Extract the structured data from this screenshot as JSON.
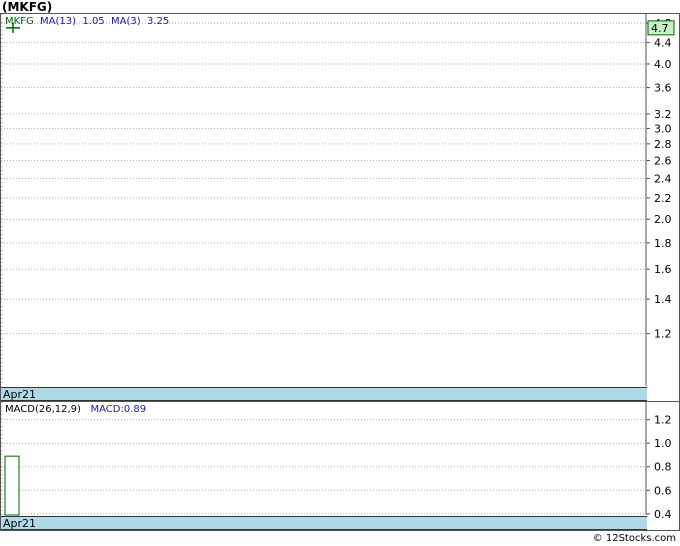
{
  "title": "(MKFG)",
  "footer": "© 12Stocks.com",
  "colors": {
    "axis_strip": "#b0dbe6",
    "price_series": "#006400",
    "ma_labels": "#1a1aa6",
    "last_price_badge": "#c8f0c8"
  },
  "price_legend": {
    "symbol": "MKFG",
    "ma13_label": "MA(13)",
    "ma13_value": "1.05",
    "ma3_label": "MA(3)",
    "ma3_value": "3.25"
  },
  "macd_legend": {
    "label": "MACD(26,12,9)",
    "macd_text": "MACD:0.89"
  },
  "chart_data": [
    {
      "type": "line",
      "panel": "price",
      "series": [
        {
          "name": "MKFG",
          "values": [
            4.7
          ]
        }
      ],
      "x": [
        "Apr21"
      ],
      "x_tick_labels": [
        "Apr21"
      ],
      "y_tick_labels": [
        "4.8",
        "4.4",
        "4.0",
        "3.6",
        "3.2",
        "3.0",
        "2.8",
        "2.6",
        "2.4",
        "2.2",
        "2.0",
        "1.8",
        "1.6",
        "1.4",
        "1.2"
      ],
      "y_ticks": [
        4.8,
        4.4,
        4.0,
        3.6,
        3.2,
        3.0,
        2.8,
        2.6,
        2.4,
        2.2,
        2.0,
        1.8,
        1.6,
        1.4,
        1.2
      ],
      "last_value_label": "4.7",
      "ylim": [
        0.95,
        5.0
      ],
      "y_scale": "log",
      "grid": true
    },
    {
      "type": "bar",
      "panel": "macd",
      "series": [
        {
          "name": "MACD",
          "values": [
            0.89
          ]
        }
      ],
      "x": [
        "Apr21"
      ],
      "x_tick_labels": [
        "Apr21"
      ],
      "y_tick_labels": [
        "1.2",
        "1.0",
        "0.8",
        "0.6",
        "0.4"
      ],
      "y_ticks": [
        1.2,
        1.0,
        0.8,
        0.6,
        0.4
      ],
      "ylim": [
        0.39,
        1.35
      ],
      "grid": true
    }
  ]
}
